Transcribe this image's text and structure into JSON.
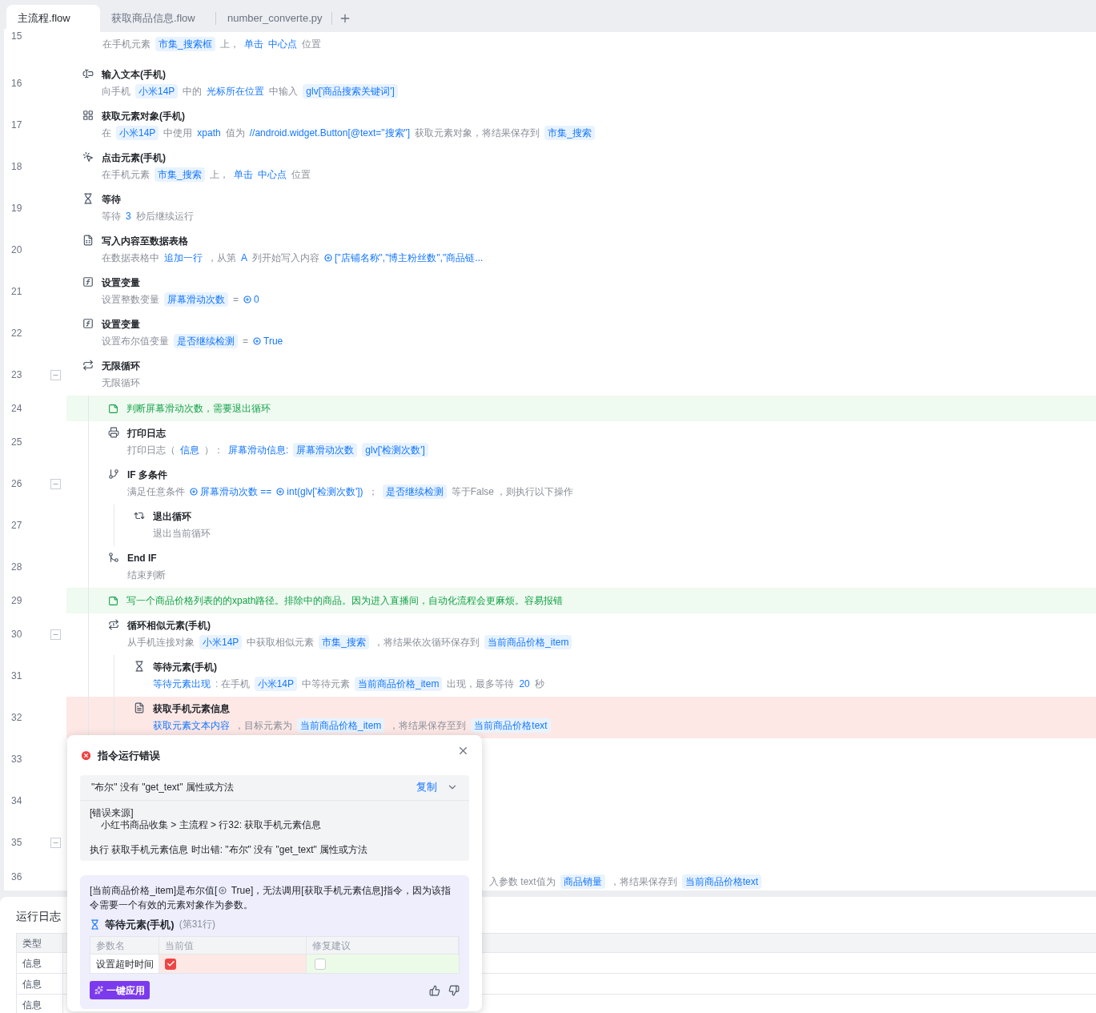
{
  "tabs": [
    {
      "label": "主流程.flow",
      "selected": true
    },
    {
      "label": "获取商品信息.flow",
      "selected": false
    },
    {
      "label": "number_converte.py",
      "selected": false
    }
  ],
  "steps": [
    {
      "line": "15",
      "kind": "cut",
      "desc": [
        {
          "kind": "text",
          "text": "在手机元素"
        },
        {
          "kind": "chip",
          "text": "市集_搜索框"
        },
        {
          "kind": "text",
          "text": "上，"
        },
        {
          "kind": "link",
          "text": "单击"
        },
        {
          "kind": "link",
          "text": "中心点"
        },
        {
          "kind": "text",
          "text": "位置"
        }
      ]
    },
    {
      "line": "16",
      "kind": "input",
      "title": "输入文本(手机)",
      "desc": [
        {
          "kind": "text",
          "text": "向手机"
        },
        {
          "kind": "chip",
          "text": "小米14P"
        },
        {
          "kind": "text",
          "text": "中的"
        },
        {
          "kind": "link",
          "text": "光标所在位置"
        },
        {
          "kind": "text",
          "text": "中输入"
        },
        {
          "kind": "chip",
          "text": "glv['商品搜索关键词']"
        }
      ]
    },
    {
      "line": "17",
      "kind": "get-element",
      "title": "获取元素对象(手机)",
      "desc": [
        {
          "kind": "text",
          "text": "在"
        },
        {
          "kind": "chip",
          "text": "小米14P"
        },
        {
          "kind": "text",
          "text": "中使用"
        },
        {
          "kind": "link",
          "text": "xpath"
        },
        {
          "kind": "text",
          "text": "值为"
        },
        {
          "kind": "link",
          "text": "//android.widget.Button[@text=\"搜索\"]"
        },
        {
          "kind": "text",
          "text": "获取元素对象，将结果保存到"
        },
        {
          "kind": "chip",
          "text": "市集_搜索"
        }
      ]
    },
    {
      "line": "18",
      "kind": "click",
      "title": "点击元素(手机)",
      "desc": [
        {
          "kind": "text",
          "text": "在手机元素"
        },
        {
          "kind": "chip",
          "text": "市集_搜索"
        },
        {
          "kind": "text",
          "text": "上，"
        },
        {
          "kind": "link",
          "text": "单击"
        },
        {
          "kind": "link",
          "text": "中心点"
        },
        {
          "kind": "text",
          "text": "位置"
        }
      ]
    },
    {
      "line": "19",
      "kind": "wait",
      "title": "等待",
      "desc": [
        {
          "kind": "text",
          "text": "等待"
        },
        {
          "kind": "link",
          "text": "3"
        },
        {
          "kind": "text",
          "text": "秒后继续运行"
        }
      ]
    },
    {
      "line": "20",
      "kind": "write-table",
      "title": "写入内容至数据表格",
      "desc": [
        {
          "kind": "text",
          "text": "在数据表格中"
        },
        {
          "kind": "link",
          "text": "追加一行"
        },
        {
          "kind": "text",
          "text": "，从第"
        },
        {
          "kind": "link",
          "text": "A"
        },
        {
          "kind": "text",
          "text": "列开始写入内容"
        },
        {
          "kind": "var",
          "text": "[\"店铺名称\",\"博主粉丝数\",\"商品链..."
        }
      ]
    },
    {
      "line": "21",
      "kind": "set-var",
      "title": "设置变量",
      "desc": [
        {
          "kind": "text",
          "text": "设置整数变量"
        },
        {
          "kind": "chip",
          "text": "屏幕滑动次数"
        },
        {
          "kind": "text",
          "text": "="
        },
        {
          "kind": "var",
          "text": "0"
        }
      ]
    },
    {
      "line": "22",
      "kind": "set-var",
      "title": "设置变量",
      "desc": [
        {
          "kind": "text",
          "text": "设置布尔值变量"
        },
        {
          "kind": "chip",
          "text": "是否继续检测"
        },
        {
          "kind": "text",
          "text": "="
        },
        {
          "kind": "var",
          "text": "True"
        }
      ]
    },
    {
      "line": "23",
      "kind": "loop",
      "title": "无限循环",
      "expanded": true,
      "desc": [
        {
          "kind": "text",
          "text": "无限循环"
        }
      ],
      "children": [
        {
          "line": "24",
          "kind": "comment",
          "title": "判断屏幕滑动次数，需要退出循环"
        },
        {
          "line": "25",
          "kind": "print",
          "title": "打印日志",
          "desc": [
            {
              "kind": "text",
              "text": "打印日志（"
            },
            {
              "kind": "link",
              "text": "信息"
            },
            {
              "kind": "text",
              "text": "）："
            },
            {
              "kind": "link",
              "text": "屏幕滑动信息:"
            },
            {
              "kind": "chip",
              "text": "屏幕滑动次数"
            },
            {
              "kind": "chip",
              "text": "glv['检测次数']"
            }
          ]
        },
        {
          "line": "26",
          "kind": "if",
          "title": "IF 多条件",
          "expanded": true,
          "desc": [
            {
              "kind": "text",
              "text": "满足任意条件"
            },
            {
              "kind": "var",
              "text": "屏幕滑动次数 =="
            },
            {
              "kind": "var",
              "text": "int(glv['检测次数'])"
            },
            {
              "kind": "text",
              "text": "；"
            },
            {
              "kind": "chip",
              "text": "是否继续检测"
            },
            {
              "kind": "text",
              "text": "等于False ，则执行以下操作"
            }
          ],
          "children": [
            {
              "line": "27",
              "kind": "break",
              "title": "退出循环",
              "desc": [
                {
                  "kind": "text",
                  "text": "退出当前循环"
                }
              ]
            }
          ]
        },
        {
          "line": "28",
          "kind": "end-if",
          "title": "End IF",
          "desc": [
            {
              "kind": "text",
              "text": "结束判断"
            }
          ]
        },
        {
          "line": "29",
          "kind": "comment",
          "title": "写一个商品价格列表的的xpath路径。排除中的商品。因为进入直播间，自动化流程会更麻烦。容易报错"
        },
        {
          "line": "30",
          "kind": "loop-similar",
          "title": "循环相似元素(手机)",
          "expanded": true,
          "desc": [
            {
              "kind": "text",
              "text": "从手机连接对象"
            },
            {
              "kind": "chip",
              "text": "小米14P"
            },
            {
              "kind": "text",
              "text": "中获取相似元素"
            },
            {
              "kind": "chip",
              "text": "市集_搜索"
            },
            {
              "kind": "text",
              "text": "，将结果依次循环保存到"
            },
            {
              "kind": "chip",
              "text": "当前商品价格_item"
            }
          ],
          "children": [
            {
              "line": "31",
              "kind": "wait-element",
              "title": "等待元素(手机)",
              "desc": [
                {
                  "kind": "link",
                  "text": "等待元素出现"
                },
                {
                  "kind": "text",
                  "text": ": 在手机"
                },
                {
                  "kind": "chip",
                  "text": "小米14P"
                },
                {
                  "kind": "text",
                  "text": "中等待元素"
                },
                {
                  "kind": "chip",
                  "text": "当前商品价格_item"
                },
                {
                  "kind": "text",
                  "text": "出现，最多等待"
                },
                {
                  "kind": "link",
                  "text": "20"
                },
                {
                  "kind": "text",
                  "text": "秒"
                }
              ]
            },
            {
              "line": "32",
              "kind": "get-info",
              "title": "获取手机元素信息",
              "error": true,
              "desc": [
                {
                  "kind": "link",
                  "text": "获取元素文本内容"
                },
                {
                  "kind": "text",
                  "text": "，目标元素为"
                },
                {
                  "kind": "chip",
                  "text": "当前商品价格_item"
                },
                {
                  "kind": "text",
                  "text": "，将结果保存至到"
                },
                {
                  "kind": "chip",
                  "text": "当前商品价格text"
                }
              ]
            },
            {
              "line": "33",
              "kind": "covered"
            },
            {
              "line": "34",
              "kind": "covered"
            },
            {
              "line": "35",
              "kind": "covered",
              "expanded": true,
              "children": [
                {
                  "line": "36",
                  "kind": "covered",
                  "desc": [
                    {
                      "kind": "text",
                      "text": "入参数 text值为"
                    },
                    {
                      "kind": "chip",
                      "text": "商品销量"
                    },
                    {
                      "kind": "text",
                      "text": "，将结果保存到"
                    },
                    {
                      "kind": "chip",
                      "text": "当前商品价格text"
                    }
                  ]
                }
              ]
            }
          ]
        }
      ]
    }
  ],
  "error_popup": {
    "title": "指令运行错误",
    "message": "\"布尔\" 没有 \"get_text\" 属性或方法",
    "copy_label": "复制",
    "source_label": "[错误来源]",
    "source_path": "小红书商品收集 > 主流程 > 行32: 获取手机元素信息",
    "detail": "执行 获取手机元素信息 时出错: \"布尔\" 没有 \"get_text\" 属性或方法",
    "suggestion": {
      "text_before": "[当前商品价格_item]是布尔值[",
      "text_after": " True]，无法调用[获取手机元素信息]指令，因为该指令需要一个有效的元素对象作为参数。",
      "step_title": "等待元素(手机)",
      "step_line": "(第31行)",
      "columns": [
        "参数名",
        "当前值",
        "修复建议"
      ],
      "rows": [
        {
          "name": "设置超时时间",
          "current_checked": true,
          "suggested_checked": false
        }
      ],
      "apply_label": "一键应用"
    }
  },
  "run_log": {
    "title": "运行日志",
    "columns": [
      "类型"
    ],
    "rows": [
      {
        "type": "信息"
      },
      {
        "type": "信息"
      },
      {
        "type": "信息"
      }
    ]
  }
}
